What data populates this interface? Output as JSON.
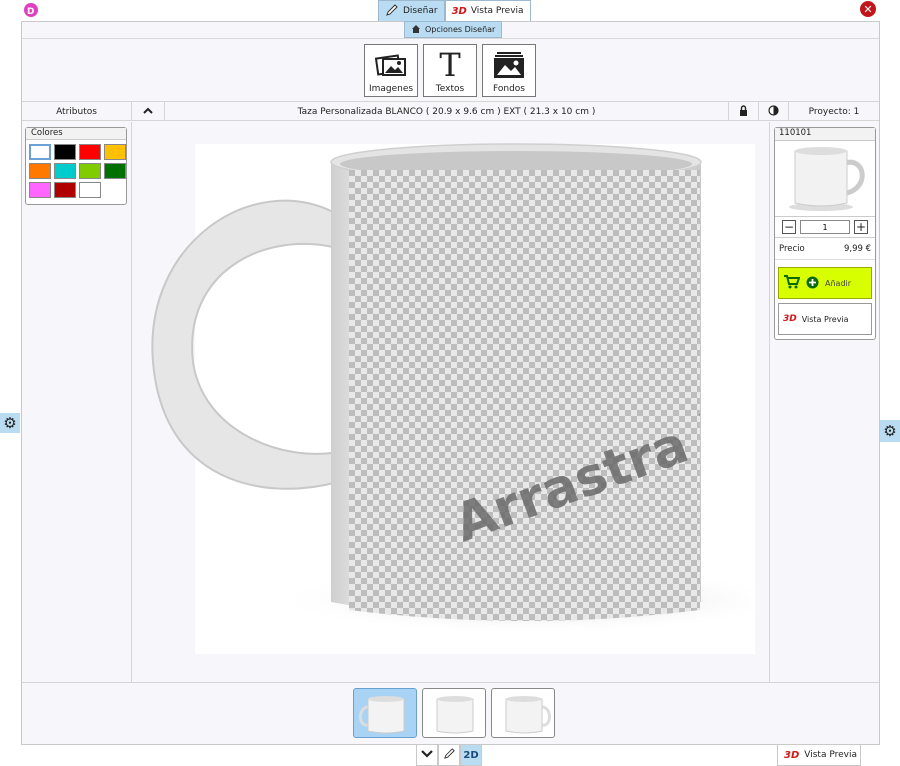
{
  "top_tabs": [
    {
      "label": "Diseñar",
      "active": true
    },
    {
      "label": "Vista Previa",
      "active": false
    }
  ],
  "sub_tab": {
    "label": "Opciones Diseñar"
  },
  "tools": [
    {
      "label": "Imagenes",
      "icon": "images-icon"
    },
    {
      "label": "Textos",
      "icon": "text-icon"
    },
    {
      "label": "Fondos",
      "icon": "backgrounds-icon"
    }
  ],
  "strip": {
    "attributes": "Atributos",
    "title": "Taza Personalizada BLANCO ( 20.9 x 9.6 cm ) EXT ( 21.3 x 10 cm )",
    "project": "Proyecto: 1"
  },
  "colors": {
    "title": "Colores",
    "swatches": [
      "#ffffff",
      "#000000",
      "#ff0000",
      "#ffc000",
      "#ff7800",
      "#00cccc",
      "#80cc00",
      "#007000",
      "#ff66ff",
      "#b00000",
      "#ffffff"
    ]
  },
  "canvas": {
    "drag_text": "Arrastra im"
  },
  "product": {
    "code": "110101",
    "quantity": "1",
    "price_label": "Precio",
    "price_value": "9,99 €",
    "add_label": "Añadir",
    "preview_label": "Vista Previa"
  },
  "bottom": {
    "preview_label": "Vista Previa",
    "twod_label": "2D"
  },
  "colors_theme": {
    "accent": "#b9dcf2",
    "add_button": "#d8ff00",
    "close": "#c0151b"
  }
}
